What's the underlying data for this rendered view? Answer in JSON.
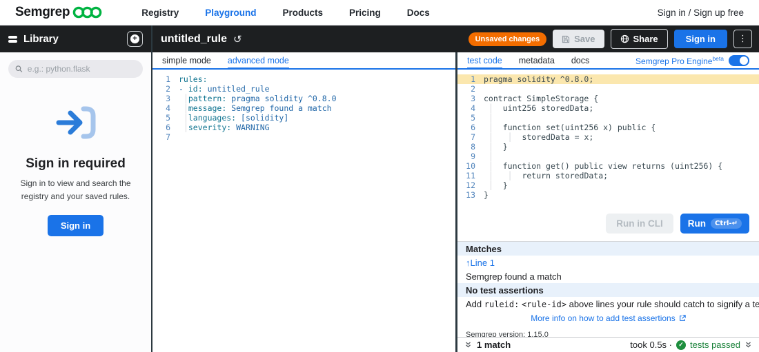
{
  "nav": {
    "brand": "Semgrep",
    "links": [
      {
        "label": "Registry",
        "active": false
      },
      {
        "label": "Playground",
        "active": true
      },
      {
        "label": "Products",
        "active": false
      },
      {
        "label": "Pricing",
        "active": false
      },
      {
        "label": "Docs",
        "active": false
      }
    ],
    "signin": "Sign in / Sign up free"
  },
  "sidebar": {
    "title": "Library",
    "search_placeholder": "e.g.: python.flask",
    "signin_title": "Sign in required",
    "signin_text": "Sign in to view and search the registry and your saved rules.",
    "signin_button": "Sign in"
  },
  "header": {
    "title": "untitled_rule",
    "badge": "Unsaved changes",
    "save_label": "Save",
    "share_label": "Share",
    "signin_label": "Sign in"
  },
  "rule_tabs": [
    {
      "label": "simple mode",
      "active": false
    },
    {
      "label": "advanced mode",
      "active": true
    }
  ],
  "test_tabs": [
    {
      "label": "test code",
      "active": true
    },
    {
      "label": "metadata",
      "active": false
    },
    {
      "label": "docs",
      "active": false
    }
  ],
  "pro_engine": {
    "label": "Semgrep Pro Engine",
    "beta": "beta",
    "enabled": true
  },
  "rule_code": [
    {
      "n": 1,
      "t": "rules:"
    },
    {
      "n": 2,
      "t": "- id: untitled_rule"
    },
    {
      "n": 3,
      "t": "  pattern: pragma solidity ^0.8.0",
      "g": [
        1
      ]
    },
    {
      "n": 4,
      "t": "  message: Semgrep found a match",
      "g": [
        1
      ]
    },
    {
      "n": 5,
      "t": "  languages: [solidity]",
      "g": [
        1
      ]
    },
    {
      "n": 6,
      "t": "  severity: WARNING",
      "g": [
        1
      ]
    },
    {
      "n": 7,
      "t": ""
    }
  ],
  "test_code": [
    {
      "n": 1,
      "t": "pragma solidity ^0.8.0;",
      "hl": true
    },
    {
      "n": 2,
      "t": ""
    },
    {
      "n": 3,
      "t": "contract SimpleStorage {"
    },
    {
      "n": 4,
      "t": "    uint256 storedData;",
      "g": [
        1
      ]
    },
    {
      "n": 5,
      "t": "",
      "g": [
        1
      ]
    },
    {
      "n": 6,
      "t": "    function set(uint256 x) public {",
      "g": [
        1
      ]
    },
    {
      "n": 7,
      "t": "        storedData = x;",
      "g": [
        1,
        5
      ]
    },
    {
      "n": 8,
      "t": "    }",
      "g": [
        1
      ]
    },
    {
      "n": 9,
      "t": "",
      "g": [
        1
      ]
    },
    {
      "n": 10,
      "t": "    function get() public view returns (uint256) {",
      "g": [
        1
      ]
    },
    {
      "n": 11,
      "t": "        return storedData;",
      "g": [
        1,
        5
      ]
    },
    {
      "n": 12,
      "t": "    }",
      "g": [
        1
      ]
    },
    {
      "n": 13,
      "t": "}"
    }
  ],
  "run": {
    "cli_label": "Run in CLI",
    "run_label": "Run",
    "kbd": "Ctrl-↵"
  },
  "results": {
    "matches_title": "Matches",
    "line_arrow": "↑",
    "line_link": "Line 1",
    "match_message": "Semgrep found a match",
    "assertions_title": "No test assertions",
    "assertion": {
      "pre": "Add ",
      "code1": "ruleid:",
      "sep": " ",
      "code2": "<rule-id>",
      "post": " above lines your rule should catch to signify a test."
    },
    "more_info": "More info on how to add test assertions",
    "version": "Semgrep version: 1.15.0"
  },
  "statusbar": {
    "matches": "1 match",
    "took": "took 0.5s ·",
    "check": "✓",
    "tests": "tests passed"
  },
  "colors": {
    "accent": "#1a73e8",
    "warning_badge": "#f36d00",
    "success_green": "#188038",
    "match_highlight": "#fbe7ae",
    "brand_green": "#00b341",
    "header_dark": "#1d1f21"
  }
}
